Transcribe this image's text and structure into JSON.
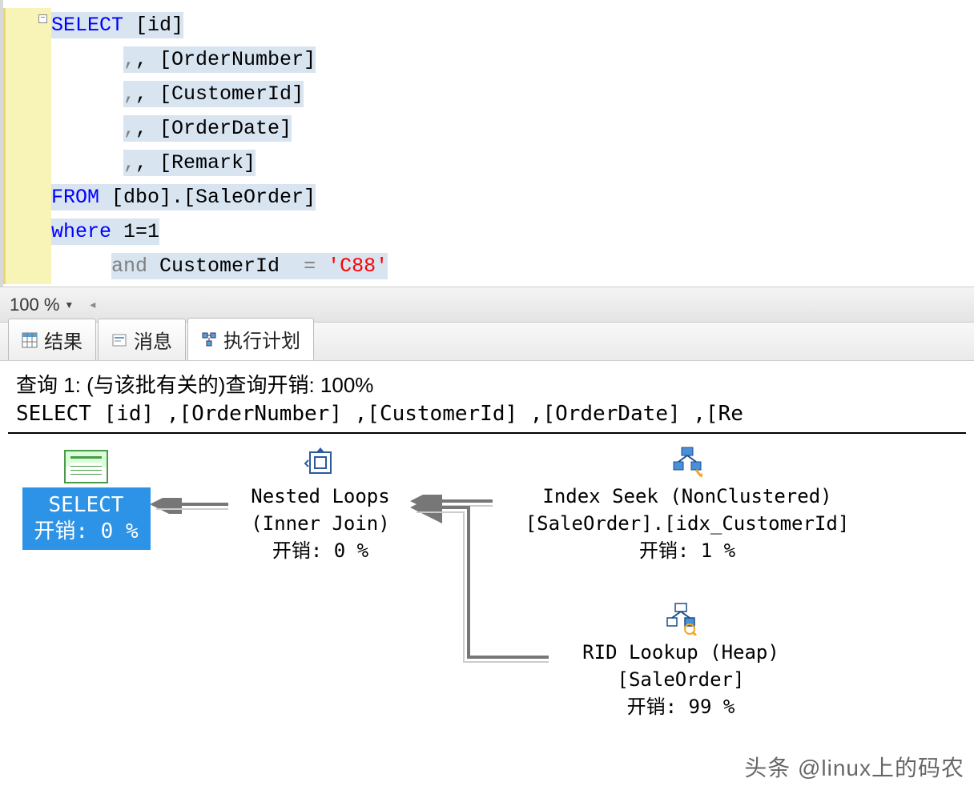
{
  "editor": {
    "sql": {
      "select_kw": "SELECT",
      "col_id": " [id]",
      "col_ordernumber": ", [OrderNumber]",
      "col_customerid": ", [CustomerId]",
      "col_orderdate": ", [OrderDate]",
      "col_remark": ", [Remark]",
      "from_kw": "FROM",
      "from_obj": " [dbo].[SaleOrder]",
      "where_kw": "where",
      "where_cond": " 1=1",
      "and_kw": "and",
      "and_col": " CustomerId  ",
      "eq": "=",
      "str_val": " 'C88'"
    }
  },
  "zoom": {
    "level": "100 %"
  },
  "tabs": {
    "results": "结果",
    "messages": "消息",
    "exec_plan": "执行计划"
  },
  "plan": {
    "header1": "查询 1: (与该批有关的)查询开销: 100%",
    "header2": "SELECT [id] ,[OrderNumber] ,[CustomerId] ,[OrderDate] ,[Re",
    "nodes": {
      "select": {
        "label": "SELECT",
        "cost": "开销: 0 %"
      },
      "nested_loops": {
        "line1": "Nested Loops",
        "line2": "(Inner Join)",
        "cost": "开销: 0 %"
      },
      "index_seek": {
        "line1": "Index Seek (NonClustered)",
        "line2": "[SaleOrder].[idx_CustomerId]",
        "cost": "开销: 1 %"
      },
      "rid_lookup": {
        "line1": "RID Lookup (Heap)",
        "line2": "[SaleOrder]",
        "cost": "开销: 99 %"
      }
    }
  },
  "watermark": "头条 @linux上的码农"
}
